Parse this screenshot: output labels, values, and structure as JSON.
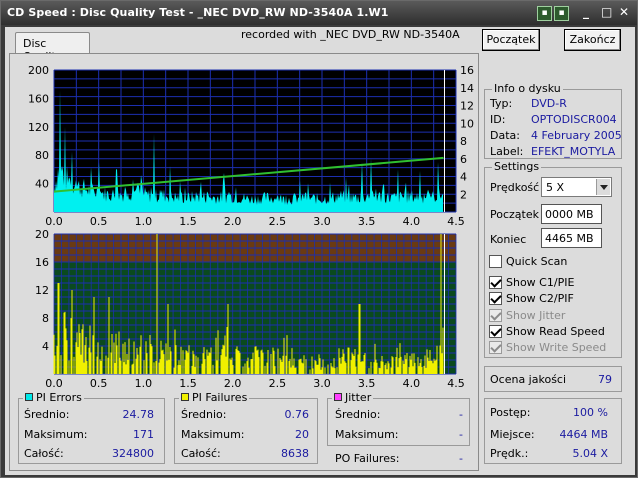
{
  "window": {
    "title": "CD Speed : Disc Quality Test - _NEC    DVD_RW ND-3540A  1.W1",
    "btn1": "▪",
    "btn2": "▪",
    "minimize": "_",
    "maximize": "□",
    "close": "✕"
  },
  "tab": {
    "label": "Disc Quality"
  },
  "recorded_with": "recorded with _NEC     DVD_RW ND-3540A",
  "buttons": {
    "start": "Początek",
    "end": "Zakończ"
  },
  "disc_info": {
    "title": "Info o dysku",
    "rows": [
      {
        "label": "Typ:",
        "value": "DVD-R"
      },
      {
        "label": "ID:",
        "value": "OPTODISCR004"
      },
      {
        "label": "Data:",
        "value": "4 February 2005"
      },
      {
        "label": "Label:",
        "value": "EFEKT_MOTYLA"
      }
    ]
  },
  "settings": {
    "title": "Settings",
    "speed_label": "Prędkość",
    "speed_value": "5 X",
    "start_label": "Początek",
    "start_value": "0000 MB",
    "end_label": "Koniec",
    "end_value": "4465 MB",
    "checks": [
      {
        "label": "Quick Scan",
        "checked": false,
        "disabled": false
      },
      {
        "label": "Show C1/PIE",
        "checked": true,
        "disabled": false
      },
      {
        "label": "Show C2/PIF",
        "checked": true,
        "disabled": false
      },
      {
        "label": "Show Jitter",
        "checked": true,
        "disabled": true
      },
      {
        "label": "Show Read Speed",
        "checked": true,
        "disabled": false
      },
      {
        "label": "Show Write Speed",
        "checked": true,
        "disabled": true
      }
    ]
  },
  "quality": {
    "label": "Ocena jakości",
    "value": "79"
  },
  "progress": {
    "rows": [
      {
        "label": "Postęp:",
        "value": "100 %"
      },
      {
        "label": "Miejsce:",
        "value": "4464 MB"
      },
      {
        "label": "Prędk.:",
        "value": "5.04 X"
      }
    ]
  },
  "pi_errors": {
    "title": "PI Errors",
    "color": "#00e8e8",
    "rows": [
      {
        "label": "Średnio:",
        "value": "24.78"
      },
      {
        "label": "Maksimum:",
        "value": "171"
      },
      {
        "label": "Całość:",
        "value": "324800"
      }
    ]
  },
  "pi_failures": {
    "title": "PI Failures",
    "color": "#f0f000",
    "rows": [
      {
        "label": "Średnio:",
        "value": "0.76"
      },
      {
        "label": "Maksimum:",
        "value": "20"
      },
      {
        "label": "Całość:",
        "value": "8638"
      }
    ]
  },
  "jitter": {
    "title": "Jitter",
    "color": "#ff40ff",
    "rows": [
      {
        "label": "Średnio:",
        "value": "-"
      },
      {
        "label": "Maksimum:",
        "value": "-"
      }
    ]
  },
  "po_failures": {
    "label": "PO Failures:",
    "value": "-"
  },
  "chart_data": [
    {
      "type": "area",
      "series": [
        {
          "name": "PI Errors",
          "color": "#00f0f0"
        },
        {
          "name": "Read Speed",
          "color": "#30c030"
        }
      ],
      "x_ticks": [
        "0.0",
        "0.5",
        "1.0",
        "1.5",
        "2.0",
        "2.5",
        "3.0",
        "3.5",
        "4.0",
        "4.5"
      ],
      "y_ticks_left": [
        "200",
        "160",
        "120",
        "80",
        "40"
      ],
      "y_ticks_right": [
        "16",
        "14",
        "12",
        "10",
        "8",
        "6",
        "4",
        "2"
      ],
      "xlim": [
        0,
        4.5
      ],
      "ylim_left": [
        0,
        200
      ],
      "ylim_right": [
        0,
        16
      ],
      "speed_line": {
        "x": [
          0.0,
          4.36
        ],
        "y": [
          2.3,
          6.1
        ]
      },
      "pi_profile": {
        "x": [
          0.0,
          0.05,
          0.1,
          0.15,
          0.2,
          0.3,
          0.4,
          0.5,
          0.6,
          0.7,
          0.8,
          0.9,
          1.0,
          1.1,
          1.2,
          1.3,
          1.4,
          1.5,
          1.6,
          1.8,
          2.0,
          2.2,
          2.4,
          2.6,
          2.8,
          3.0,
          3.2,
          3.4,
          3.6,
          3.8,
          4.0,
          4.2,
          4.36
        ],
        "y": [
          35,
          60,
          55,
          45,
          38,
          35,
          30,
          28,
          25,
          24,
          26,
          28,
          25,
          22,
          24,
          22,
          20,
          20,
          22,
          20,
          22,
          18,
          20,
          18,
          20,
          18,
          22,
          20,
          22,
          20,
          22,
          20,
          25
        ]
      },
      "pi_spikes": [
        {
          "x": 0.07,
          "y": 171
        },
        {
          "x": 0.12,
          "y": 120
        },
        {
          "x": 0.2,
          "y": 85
        },
        {
          "x": 0.5,
          "y": 70
        },
        {
          "x": 0.7,
          "y": 60
        },
        {
          "x": 1.12,
          "y": 110
        },
        {
          "x": 1.3,
          "y": 65
        },
        {
          "x": 1.9,
          "y": 55
        },
        {
          "x": 3.45,
          "y": 70
        },
        {
          "x": 3.55,
          "y": 75
        },
        {
          "x": 3.85,
          "y": 60
        },
        {
          "x": 4.1,
          "y": 58
        },
        {
          "x": 4.3,
          "y": 70
        }
      ]
    },
    {
      "type": "bar",
      "series": [
        {
          "name": "PI Failures",
          "color": "#f0f000"
        }
      ],
      "x_ticks": [
        "0.0",
        "0.5",
        "1.0",
        "1.5",
        "2.0",
        "2.5",
        "3.0",
        "3.5",
        "4.0",
        "4.5"
      ],
      "y_ticks": [
        "20",
        "16",
        "12",
        "8",
        "4"
      ],
      "xlim": [
        0,
        4.5
      ],
      "ylim": [
        0,
        20
      ],
      "threshold": 16,
      "pif_profile": {
        "x": [
          0.0,
          0.1,
          0.2,
          0.4,
          0.6,
          0.8,
          1.0,
          1.1,
          1.3,
          1.5,
          1.8,
          2.0,
          2.2,
          2.5,
          2.8,
          3.0,
          3.3,
          3.6,
          3.9,
          4.2,
          4.36
        ],
        "y": [
          6,
          7,
          6,
          5,
          5,
          4,
          4,
          4,
          3,
          3,
          3,
          3,
          3,
          3,
          2,
          2,
          3,
          2,
          2,
          3,
          3
        ]
      },
      "pif_spikes": [
        {
          "x": 0.05,
          "y": 13
        },
        {
          "x": 0.2,
          "y": 12
        },
        {
          "x": 0.45,
          "y": 11
        },
        {
          "x": 0.62,
          "y": 11
        },
        {
          "x": 1.15,
          "y": 20
        },
        {
          "x": 1.28,
          "y": 10
        },
        {
          "x": 1.95,
          "y": 10
        },
        {
          "x": 3.42,
          "y": 10
        },
        {
          "x": 4.33,
          "y": 20
        }
      ]
    }
  ]
}
